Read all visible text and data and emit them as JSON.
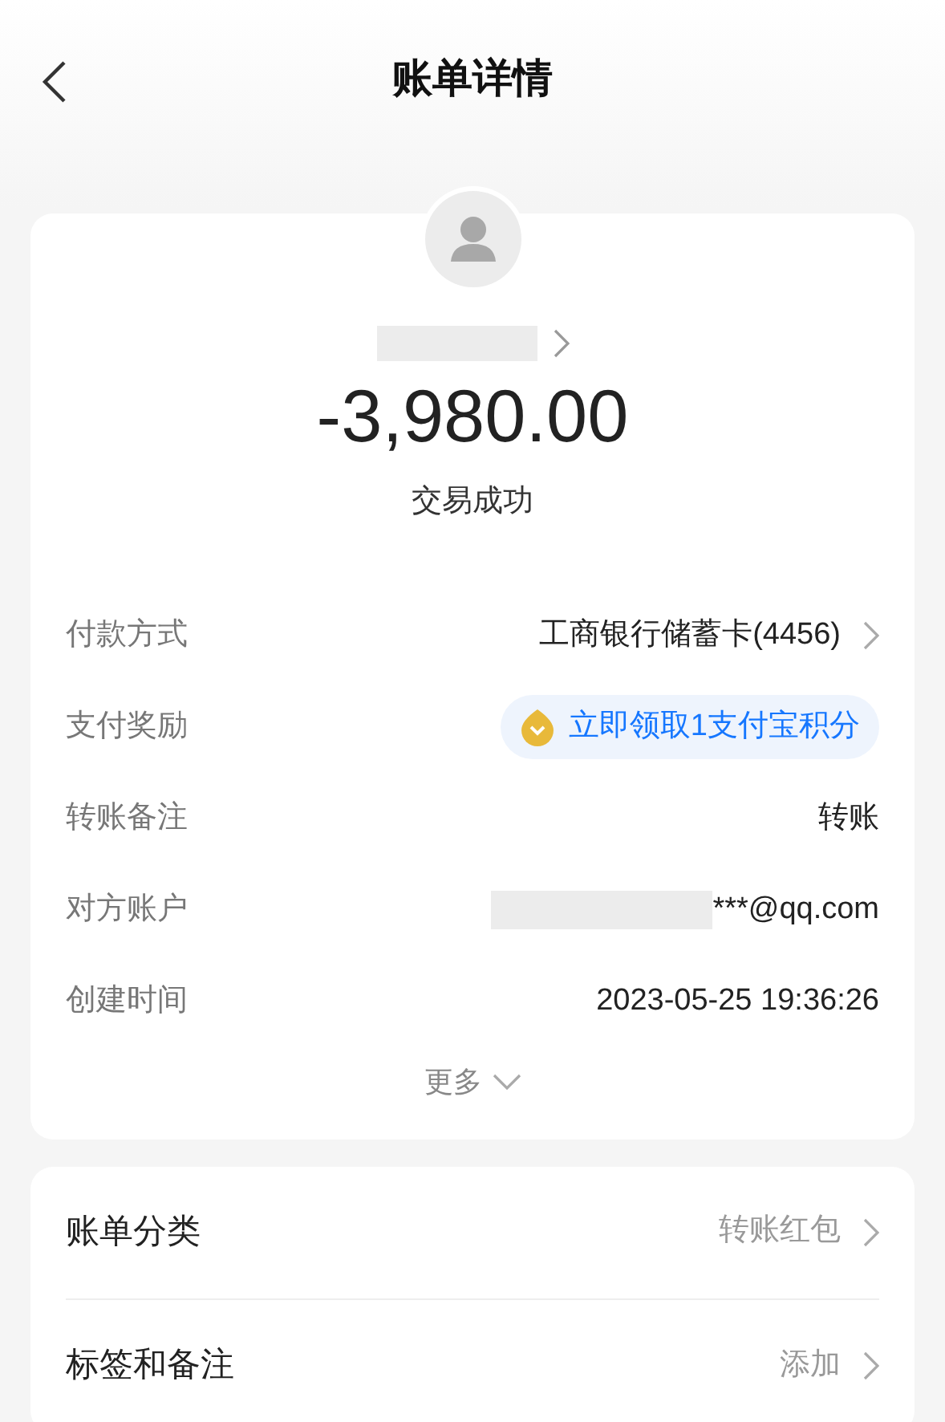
{
  "header": {
    "title": "账单详情"
  },
  "summary": {
    "name_redacted": true,
    "amount": "-3,980.00",
    "status": "交易成功"
  },
  "details": [
    {
      "kind": "link",
      "label": "付款方式",
      "value": "工商银行储蓄卡(4456)"
    },
    {
      "kind": "reward",
      "label": "支付奖励",
      "value": "立即领取1支付宝积分"
    },
    {
      "kind": "text",
      "label": "转账备注",
      "value": "转账"
    },
    {
      "kind": "redacted",
      "label": "对方账户",
      "value": "***@qq.com"
    },
    {
      "kind": "text",
      "label": "创建时间",
      "value": "2023-05-25 19:36:26"
    }
  ],
  "more": {
    "label": "更多"
  },
  "settings": [
    {
      "label": "账单分类",
      "value": "转账红包"
    },
    {
      "label": "标签和备注",
      "value": "添加"
    }
  ]
}
